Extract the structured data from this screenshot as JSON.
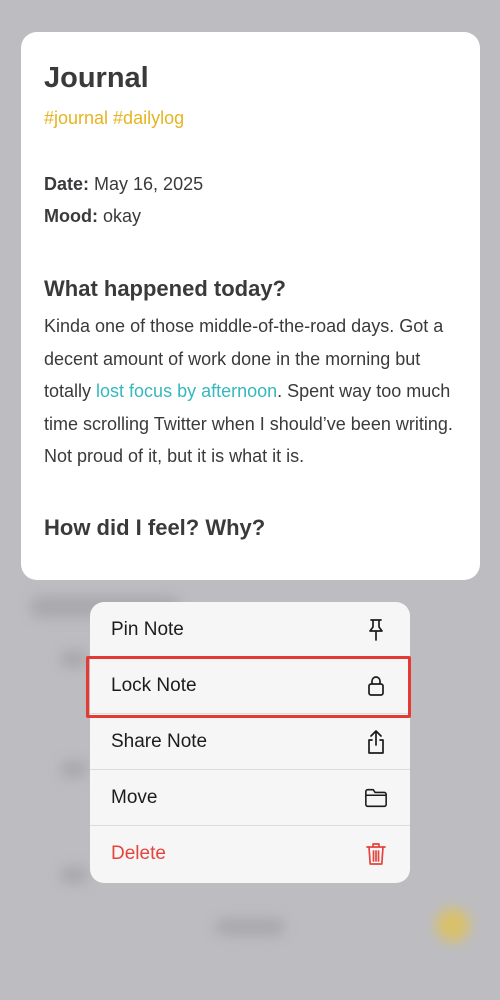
{
  "note": {
    "title": "Journal",
    "tags": "#journal #dailylog",
    "date_label": "Date:",
    "date_value": "May 16, 2025",
    "mood_label": "Mood:",
    "mood_value": "okay",
    "section1_heading": "What happened today?",
    "para_before_link": "Kinda one of those middle-of-the-road days. Got a decent amount of work done in the morning but totally ",
    "para_link": "lost focus by afternoon",
    "para_after_link": ". Spent way too much time scrolling Twitter when I should’ve been writing. Not proud of it, but it is what it is.",
    "section2_heading": "How did I feel? Why?"
  },
  "menu": {
    "items": [
      {
        "label": "Pin Note",
        "icon": "pin-icon"
      },
      {
        "label": "Lock Note",
        "icon": "lock-icon"
      },
      {
        "label": "Share Note",
        "icon": "share-icon"
      },
      {
        "label": "Move",
        "icon": "folder-icon"
      },
      {
        "label": "Delete",
        "icon": "trash-icon"
      }
    ]
  },
  "colors": {
    "tag": "#e6b422",
    "link": "#35b8be",
    "danger": "#e5443d",
    "highlight": "#e53935"
  }
}
